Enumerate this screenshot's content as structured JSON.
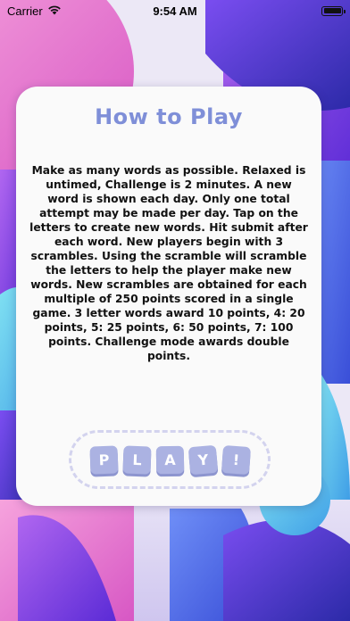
{
  "status_bar": {
    "carrier": "Carrier",
    "time": "9:54 AM"
  },
  "card": {
    "title": "How to Play",
    "instructions": "Make as many words as possible. Relaxed is untimed, Challenge is 2 minutes. A new word is shown each day. Only one total attempt may be made per day. Tap on the letters to create new words. Hit submit after each word. New players begin with 3 scrambles. Using the scramble will scramble the letters to help the player make new words. New scrambles are obtained for each multiple of 250 points scored in a single game. 3 letter words award 10 points, 4: 20 points, 5: 25 points, 6: 50 points, 7: 100 points. Challenge mode awards double points."
  },
  "play_button": {
    "letters": [
      "P",
      "L",
      "A",
      "Y",
      "!"
    ]
  },
  "colors": {
    "title": "#7f8fd8",
    "tile": "#abb2e2",
    "tile_shadow": "#8d95cf",
    "dashed_border": "#d3d3ee",
    "bg_purple": "#8a3fe0",
    "bg_blue": "#4a7df0",
    "bg_pink": "#f072c9",
    "bg_cyan": "#5ec6e8"
  },
  "icons": {
    "wifi": "wifi-icon",
    "battery": "battery-icon"
  }
}
